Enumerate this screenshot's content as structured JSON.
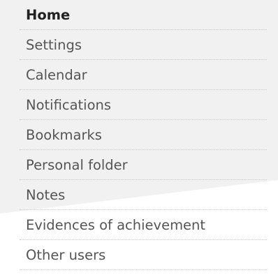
{
  "navigation": {
    "items": [
      {
        "label": "Home",
        "active": true
      },
      {
        "label": "Settings",
        "active": false
      },
      {
        "label": "Calendar",
        "active": false
      },
      {
        "label": "Notifications",
        "active": false
      },
      {
        "label": "Bookmarks",
        "active": false
      },
      {
        "label": "Personal folder",
        "active": false
      },
      {
        "label": "Notes",
        "active": false
      },
      {
        "label": "Evidences of achievement",
        "active": false
      },
      {
        "label": "Other users",
        "active": false
      }
    ]
  },
  "colors": {
    "background": "#ffffff",
    "panel": "#f2f2f2",
    "text": "#555555",
    "active_text": "#222222",
    "divider": "#c9c9c9"
  }
}
